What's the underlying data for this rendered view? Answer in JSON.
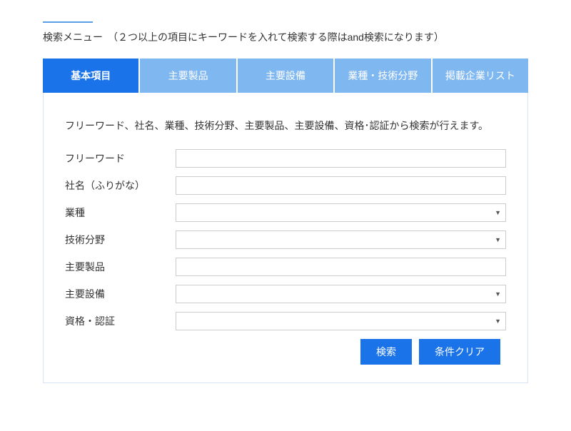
{
  "header": {
    "title": "検索メニュー　（２つ以上の項目にキーワードを入れて検索する際はand検索になります）"
  },
  "tabs": [
    {
      "label": "基本項目",
      "active": true
    },
    {
      "label": "主要製品",
      "active": false
    },
    {
      "label": "主要設備",
      "active": false
    },
    {
      "label": "業種・技術分野",
      "active": false
    },
    {
      "label": "掲載企業リスト",
      "active": false
    }
  ],
  "panel": {
    "description": "フリーワード、社名、業種、技術分野、主要製品、主要設備、資格･認証から検索が行えます。",
    "fields": {
      "freeword": {
        "label": "フリーワード"
      },
      "company": {
        "label": "社名（ふりがな）"
      },
      "industry": {
        "label": "業種"
      },
      "techfield": {
        "label": "技術分野"
      },
      "product": {
        "label": "主要製品"
      },
      "equipment": {
        "label": "主要設備"
      },
      "cert": {
        "label": "資格・認証"
      }
    },
    "buttons": {
      "search": "検索",
      "clear": "条件クリア"
    }
  }
}
